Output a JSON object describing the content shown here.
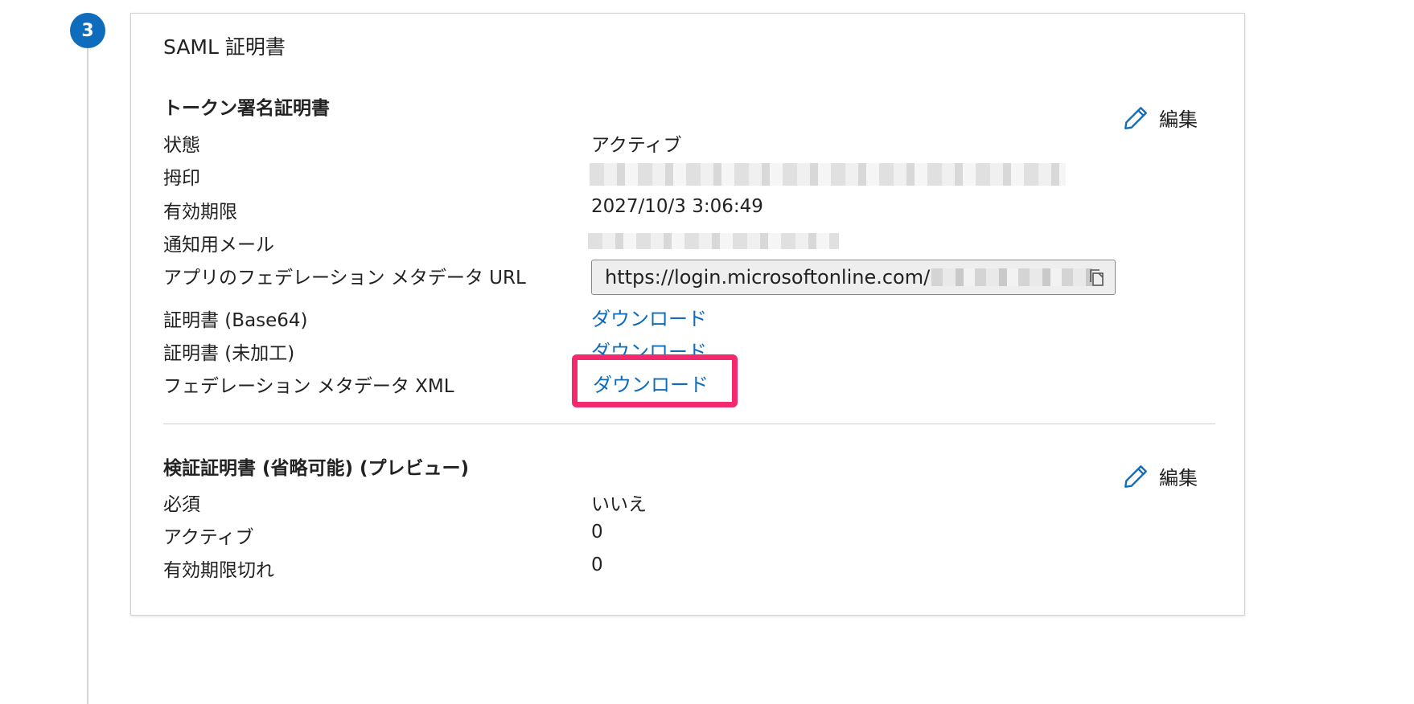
{
  "step": {
    "number": "3"
  },
  "card": {
    "title": "SAML 証明書"
  },
  "token_section": {
    "title": "トークン署名証明書",
    "edit_label": "編集",
    "rows": {
      "status": {
        "label": "状態",
        "value": "アクティブ"
      },
      "thumbprint": {
        "label": "拇印"
      },
      "expiration": {
        "label": "有効期限",
        "value": "2027/10/3 3:06:49"
      },
      "notification_email": {
        "label": "通知用メール"
      },
      "metadata_url": {
        "label": "アプリのフェデレーション メタデータ URL",
        "value": "https://login.microsoftonline.com/"
      },
      "cert_base64": {
        "label": "証明書 (Base64)",
        "link": "ダウンロード"
      },
      "cert_raw": {
        "label": "証明書 (未加工)",
        "link": "ダウンロード"
      },
      "federation_xml": {
        "label": "フェデレーション メタデータ XML",
        "link": "ダウンロード"
      }
    }
  },
  "verify_section": {
    "title": "検証証明書 (省略可能) (プレビュー)",
    "edit_label": "編集",
    "rows": {
      "required": {
        "label": "必須",
        "value": "いいえ"
      },
      "active": {
        "label": "アクティブ",
        "value": "0"
      },
      "expired": {
        "label": "有効期限切れ",
        "value": "0"
      }
    }
  },
  "colors": {
    "accent": "#0f6cbd",
    "highlight": "#f2296e"
  },
  "icons": {
    "edit": "pencil-icon",
    "copy": "copy-icon"
  }
}
